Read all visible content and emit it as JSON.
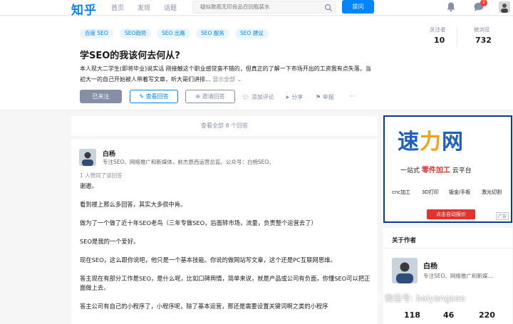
{
  "nav": {
    "logo": "知乎",
    "items": [
      "首页",
      "发现",
      "话题"
    ],
    "search_placeholder": "疑似致癌无印良品召回瓶装水",
    "ask_label": "提问",
    "message_badge": "2"
  },
  "question": {
    "tags": [
      "百度 SEO",
      "SEO趋势",
      "SEO 出路",
      "SEO 服务",
      "SEO 建议"
    ],
    "title": "学SEO的我该何去何从?",
    "desc_text": "本人现大二学生(即将毕业)说实话 刚接触这个职业感觉蛮不错的，但真正的了解一下市场开出的工资我有点失落，当初大一的自己开始被人带着写文章，听大哥们讲排...",
    "show_all": "显示全部 ⌄",
    "follow_label": "已关注",
    "write_label": "查看回答",
    "invite_label": "邀请回答",
    "comment_label": "添加评论",
    "share_label": "分享",
    "report_label": "举报",
    "more_label": "···",
    "followers_label": "关注者",
    "followers_value": "10",
    "views_label": "被浏览",
    "views_value": "732"
  },
  "answers": {
    "view_all": "查看全部 8 个回答",
    "author_name": "白杨",
    "author_bio": "专注SEO、网络推广和新媒体，前杰恩西运营总监。公众号：白杨SEO。",
    "votes": "1 人赞同了该回答",
    "paragraphs": [
      "谢邀。",
      "看到楼上那么多回答，其实大多很中肯。",
      "做为了一个做了近十年SEO老鸟（三年专做SEO，后面转市场，流量，负责整个运营去了）",
      "SEO是我的一个爱好。",
      "现在SEO，这么跟你说吧，他只是一个基本技能。你说的做网站写文章，这个还是PC互联网思维。",
      "答主现在有部分工作是SEO，是什么呢，比如口碑舆情，简单来说，就是产品或公司有负面，你懂SEO可以把正面做上去。",
      "答主公司有自己的小程序了，小程序呢，除了基本运营，那还是需要设置关键词啊之类的小程序"
    ]
  },
  "ad": {
    "logo_left": "速",
    "logo_bolt": "力",
    "logo_right": "网",
    "line_prefix": "一站式",
    "line_highlight": "零件加工",
    "line_suffix": "云平台",
    "categories": [
      "cnc加工",
      "3D打印",
      "钣金/手板",
      "激光切割"
    ],
    "cta": "点击自动报价",
    "badge": "广告"
  },
  "about": {
    "heading": "关于作者",
    "name": "白杨",
    "bio": "专注SEO、网络推广和新媒...",
    "stats": [
      "118",
      "46",
      "220"
    ]
  },
  "watermark": "微信号: baiyangseo",
  "colors": {
    "brand": "#0084ff",
    "muted": "#8590a6",
    "ad_blue": "#1f5fbf",
    "ad_red": "#e4332f"
  }
}
